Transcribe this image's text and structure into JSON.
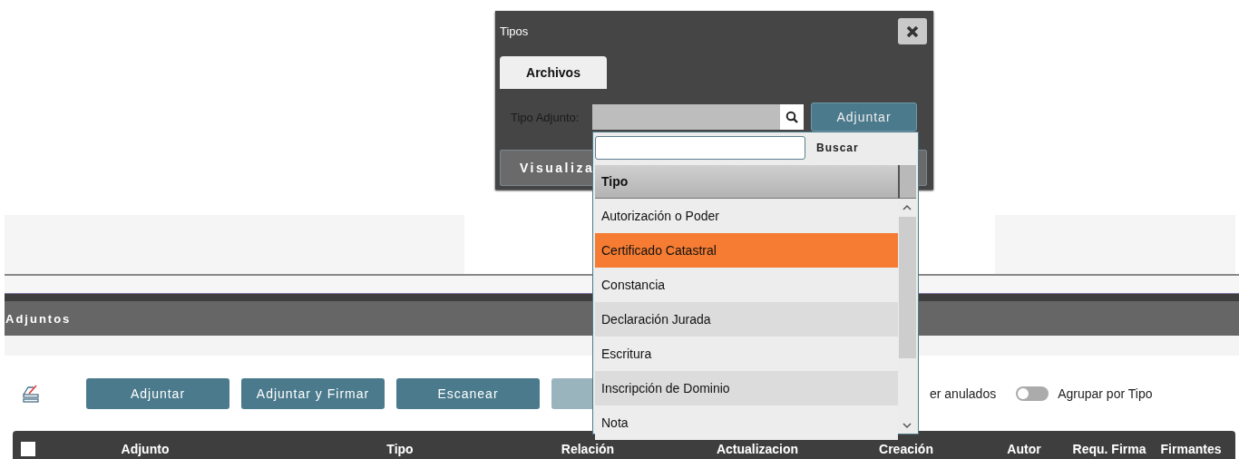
{
  "page": {
    "section_title": "Adjuntos",
    "toolbar": {
      "buttons": [
        {
          "label": "Adjuntar"
        },
        {
          "label": "Adjuntar y Firmar"
        },
        {
          "label": "Escanear"
        }
      ],
      "covered_button": {
        "disabled": true
      },
      "partial_label": "er anulados",
      "group_toggle": {
        "label": "Agrupar por Tipo",
        "on": false
      }
    },
    "table": {
      "select_all": {
        "checked": false
      },
      "columns": [
        "Adjunto",
        "Tipo",
        "Relación",
        "Actualizacion",
        "Creación",
        "Autor",
        "Requ. Firma",
        "Firmantes"
      ]
    }
  },
  "dialog": {
    "title": "Tipos",
    "tabs": [
      {
        "label": "Archivos",
        "selected": true
      }
    ],
    "field_label": "Tipo Adjunto:",
    "attach_button": "Adjuntar",
    "view_button": "Visualiza"
  },
  "dropdown": {
    "search_button": "Buscar",
    "column": "Tipo",
    "items": [
      {
        "label": "Autorización o Poder",
        "selected": false
      },
      {
        "label": "Certificado Catastral",
        "selected": true
      },
      {
        "label": "Constancia",
        "selected": false
      },
      {
        "label": "Declaración Jurada",
        "selected": false
      },
      {
        "label": "Escritura",
        "selected": false
      },
      {
        "label": "Inscripción de Dominio",
        "selected": false
      },
      {
        "label": "Nota",
        "selected": false
      }
    ]
  }
}
